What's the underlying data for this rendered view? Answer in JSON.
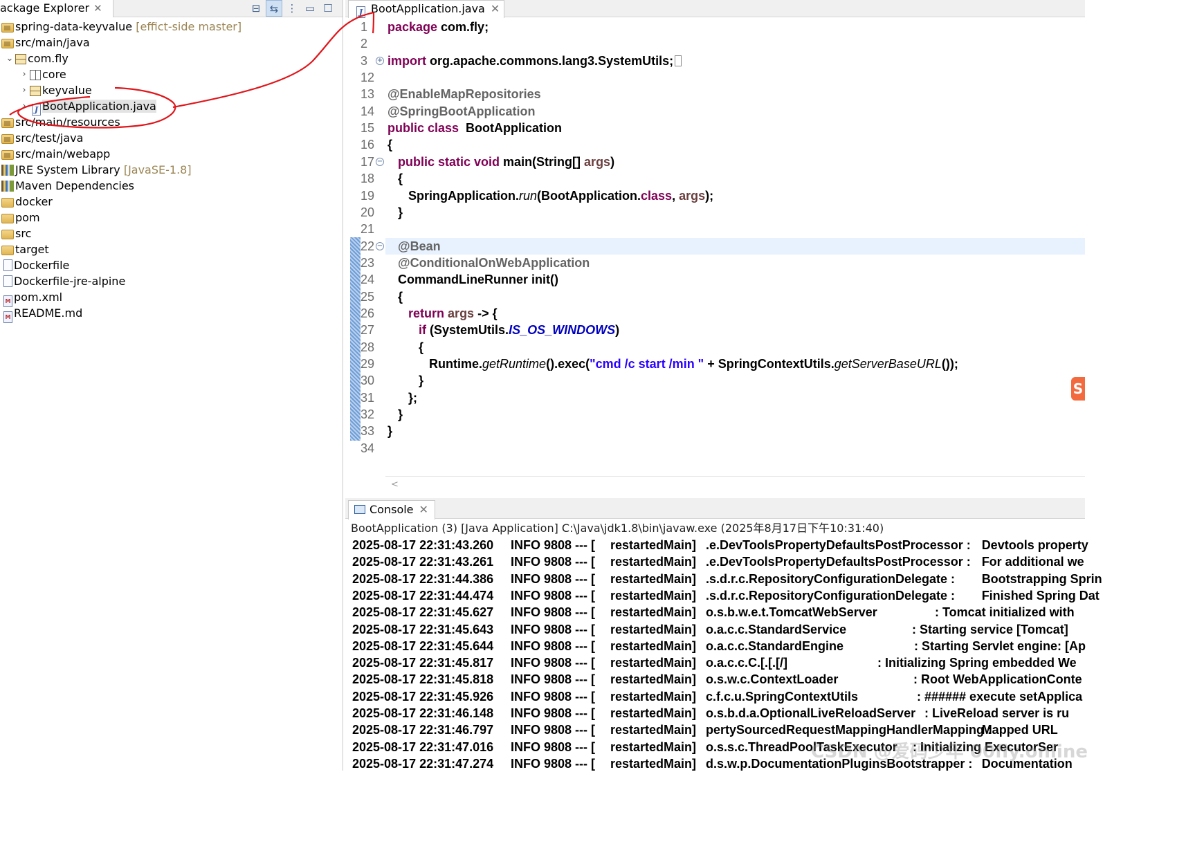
{
  "explorer": {
    "tab_label": "ackage Explorer",
    "tree": [
      {
        "label": "spring-data-keyvalue",
        "deco": "[effict-side master]",
        "icon": "project-icon",
        "twisty": "",
        "indent": 0
      },
      {
        "label": "src/main/java",
        "deco": "",
        "icon": "source-folder-icon",
        "twisty": "",
        "indent": 0
      },
      {
        "label": "com.fly",
        "deco": "",
        "icon": "package-icon",
        "twisty": "expanded",
        "indent": 1
      },
      {
        "label": "core",
        "deco": "",
        "icon": "empty-package-icon",
        "twisty": "collapsed",
        "indent": 2
      },
      {
        "label": "keyvalue",
        "deco": "",
        "icon": "package-icon",
        "twisty": "collapsed",
        "indent": 2
      },
      {
        "label": "BootApplication.java",
        "deco": "",
        "icon": "java-file-icon",
        "twisty": "collapsed",
        "indent": 2,
        "selected": true
      },
      {
        "label": "src/main/resources",
        "deco": "",
        "icon": "source-folder-icon",
        "twisty": "",
        "indent": 0
      },
      {
        "label": "src/test/java",
        "deco": "",
        "icon": "source-folder-icon",
        "twisty": "",
        "indent": 0
      },
      {
        "label": "src/main/webapp",
        "deco": "",
        "icon": "source-folder-icon",
        "twisty": "",
        "indent": 0
      },
      {
        "label": "JRE System Library",
        "deco": "[JavaSE-1.8]",
        "icon": "library-icon",
        "twisty": "",
        "indent": 0
      },
      {
        "label": "Maven Dependencies",
        "deco": "",
        "icon": "library-icon",
        "twisty": "",
        "indent": 0
      },
      {
        "label": "docker",
        "deco": "",
        "icon": "folder-icon",
        "twisty": "",
        "indent": 0
      },
      {
        "label": "pom",
        "deco": "",
        "icon": "folder-icon",
        "twisty": "",
        "indent": 0
      },
      {
        "label": "src",
        "deco": "",
        "icon": "folder-icon",
        "twisty": "",
        "indent": 0
      },
      {
        "label": "target",
        "deco": "",
        "icon": "folder-icon",
        "twisty": "",
        "indent": 0
      },
      {
        "label": "Dockerfile",
        "deco": "",
        "icon": "file-icon",
        "twisty": "",
        "indent": 0
      },
      {
        "label": "Dockerfile-jre-alpine",
        "deco": "",
        "icon": "file-icon",
        "twisty": "",
        "indent": 0
      },
      {
        "label": "pom.xml",
        "deco": "",
        "icon": "xml-file-icon",
        "twisty": "",
        "indent": 0
      },
      {
        "label": "README.md",
        "deco": "",
        "icon": "markdown-file-icon",
        "twisty": "",
        "indent": 0
      }
    ]
  },
  "editor": {
    "tab_label": "BootApplication.java",
    "lines": [
      {
        "n": "1",
        "code": [
          [
            "kw",
            "package"
          ],
          [
            "t",
            " com.fly;"
          ]
        ]
      },
      {
        "n": "2",
        "code": []
      },
      {
        "n": "3",
        "code": [
          [
            "kw",
            "import"
          ],
          [
            "t",
            " org.apache.commons.lang3.SystemUtils;"
          ]
        ],
        "fold": "+",
        "collapsed": true
      },
      {
        "n": "12",
        "code": []
      },
      {
        "n": "13",
        "code": [
          [
            "ann",
            "@EnableMapRepositories"
          ]
        ]
      },
      {
        "n": "14",
        "code": [
          [
            "ann",
            "@SpringBootApplication"
          ]
        ]
      },
      {
        "n": "15",
        "code": [
          [
            "kw",
            "public class"
          ],
          [
            "t",
            "  BootApplication"
          ]
        ]
      },
      {
        "n": "16",
        "code": [
          [
            "t",
            "{"
          ]
        ]
      },
      {
        "n": "17",
        "code": [
          [
            "t",
            "   "
          ],
          [
            "kw",
            "public static void"
          ],
          [
            "t",
            " main(String[] "
          ],
          [
            "var",
            "args"
          ],
          [
            "t",
            ")"
          ]
        ],
        "fold": "−"
      },
      {
        "n": "18",
        "code": [
          [
            "t",
            "   {"
          ]
        ]
      },
      {
        "n": "19",
        "code": [
          [
            "t",
            "      SpringApplication."
          ],
          [
            "it",
            "run"
          ],
          [
            "t",
            "(BootApplication."
          ],
          [
            "kw",
            "class"
          ],
          [
            "t",
            ", "
          ],
          [
            "var",
            "args"
          ],
          [
            "t",
            ");"
          ]
        ]
      },
      {
        "n": "20",
        "code": [
          [
            "t",
            "   }"
          ]
        ]
      },
      {
        "n": "21",
        "code": []
      },
      {
        "n": "22",
        "code": [
          [
            "t",
            "   "
          ],
          [
            "ann",
            "@Bean"
          ]
        ],
        "fold": "−",
        "highlight": true
      },
      {
        "n": "23",
        "code": [
          [
            "t",
            "   "
          ],
          [
            "ann",
            "@ConditionalOnWebApplication"
          ]
        ]
      },
      {
        "n": "24",
        "code": [
          [
            "t",
            "   CommandLineRunner init()"
          ]
        ]
      },
      {
        "n": "25",
        "code": [
          [
            "t",
            "   {"
          ]
        ]
      },
      {
        "n": "26",
        "code": [
          [
            "t",
            "      "
          ],
          [
            "kw",
            "return"
          ],
          [
            "t",
            " "
          ],
          [
            "var",
            "args"
          ],
          [
            "t",
            " -> {"
          ]
        ]
      },
      {
        "n": "27",
        "code": [
          [
            "t",
            "         "
          ],
          [
            "kw",
            "if"
          ],
          [
            "t",
            " (SystemUtils."
          ],
          [
            "cst",
            "IS_OS_WINDOWS"
          ],
          [
            "t",
            ")"
          ]
        ]
      },
      {
        "n": "28",
        "code": [
          [
            "t",
            "         {"
          ]
        ]
      },
      {
        "n": "29",
        "code": [
          [
            "t",
            "            Runtime."
          ],
          [
            "it",
            "getRuntime"
          ],
          [
            "t",
            "().exec("
          ],
          [
            "str",
            "\"cmd /c start /min \""
          ],
          [
            "t",
            " + SpringContextUtils."
          ],
          [
            "it",
            "getServerBaseURL"
          ],
          [
            "t",
            "());"
          ]
        ]
      },
      {
        "n": "30",
        "code": [
          [
            "t",
            "         }"
          ]
        ]
      },
      {
        "n": "31",
        "code": [
          [
            "t",
            "      };"
          ]
        ]
      },
      {
        "n": "32",
        "code": [
          [
            "t",
            "   }"
          ]
        ]
      },
      {
        "n": "33",
        "code": [
          [
            "t",
            "}"
          ]
        ]
      },
      {
        "n": "34",
        "code": []
      }
    ],
    "scroll_glyph": "<"
  },
  "console": {
    "tab_label": "Console",
    "header": "BootApplication (3) [Java Application] C:\\Java\\jdk1.8\\bin\\javaw.exe  (2025年8月17日下午10:31:40)",
    "log_rows": [
      {
        "time": "2025-08-17 22:31:43.260",
        "level": "INFO 9808 --- [",
        "thread": "restartedMain]",
        "logger": ".e.DevToolsPropertyDefaultsPostProcessor :",
        "msg": "Devtools property"
      },
      {
        "time": "2025-08-17 22:31:43.261",
        "level": "INFO 9808 --- [",
        "thread": "restartedMain]",
        "logger": ".e.DevToolsPropertyDefaultsPostProcessor :",
        "msg": "For additional we"
      },
      {
        "time": "2025-08-17 22:31:44.386",
        "level": "INFO 9808 --- [",
        "thread": "restartedMain]",
        "logger": ".s.d.r.c.RepositoryConfigurationDelegate :",
        "msg": "Bootstrapping Sprin"
      },
      {
        "time": "2025-08-17 22:31:44.474",
        "level": "INFO 9808 --- [",
        "thread": "restartedMain]",
        "logger": ".s.d.r.c.RepositoryConfigurationDelegate :",
        "msg": "Finished Spring Dat"
      },
      {
        "time": "2025-08-17 22:31:45.627",
        "level": "INFO 9808 --- [",
        "thread": "restartedMain]",
        "logger": "o.s.b.w.e.t.TomcatWebServer",
        "msg": ": Tomcat initialized with"
      },
      {
        "time": "2025-08-17 22:31:45.643",
        "level": "INFO 9808 --- [",
        "thread": "restartedMain]",
        "logger": "o.a.c.c.StandardService",
        "msg": ": Starting service [Tomcat]"
      },
      {
        "time": "2025-08-17 22:31:45.644",
        "level": "INFO 9808 --- [",
        "thread": "restartedMain]",
        "logger": "o.a.c.c.StandardEngine",
        "msg": ": Starting Servlet engine: [Ap"
      },
      {
        "time": "2025-08-17 22:31:45.817",
        "level": "INFO 9808 --- [",
        "thread": "restartedMain]",
        "logger": "o.a.c.c.C.[.[.[/]",
        "msg": ": Initializing Spring embedded We"
      },
      {
        "time": "2025-08-17 22:31:45.818",
        "level": "INFO 9808 --- [",
        "thread": "restartedMain]",
        "logger": "o.s.w.c.ContextLoader",
        "msg": ": Root WebApplicationConte"
      },
      {
        "time": "2025-08-17 22:31:45.926",
        "level": "INFO 9808 --- [",
        "thread": "restartedMain]",
        "logger": "c.f.c.u.SpringContextUtils",
        "msg": ": ###### execute setApplica"
      },
      {
        "time": "2025-08-17 22:31:46.148",
        "level": "INFO 9808 --- [",
        "thread": "restartedMain]",
        "logger": "o.s.b.d.a.OptionalLiveReloadServer",
        "msg": ": LiveReload server is ru"
      },
      {
        "time": "2025-08-17 22:31:46.797",
        "level": "INFO 9808 --- [",
        "thread": "restartedMain]",
        "logger": "pertySourcedRequestMappingHandlerMapping :",
        "msg": "Mapped URL"
      },
      {
        "time": "2025-08-17 22:31:47.016",
        "level": "INFO 9808 --- [",
        "thread": "restartedMain]",
        "logger": "o.s.s.c.ThreadPoolTaskExecutor",
        "msg": ": Initializing ExecutorSer"
      },
      {
        "time": "2025-08-17 22:31:47.274",
        "level": "INFO 9808 --- [",
        "thread": "restartedMain]",
        "logger": "d.s.w.p.DocumentationPluginsBootstrapper :",
        "msg": "Documentation"
      }
    ]
  },
  "watermark": "CSDN @爱码少年 00fly.online",
  "colors": {
    "annotation_pen": "#e0161b",
    "keyword": "#7f0055",
    "string": "#2a00ff",
    "constant": "#0000c0"
  }
}
